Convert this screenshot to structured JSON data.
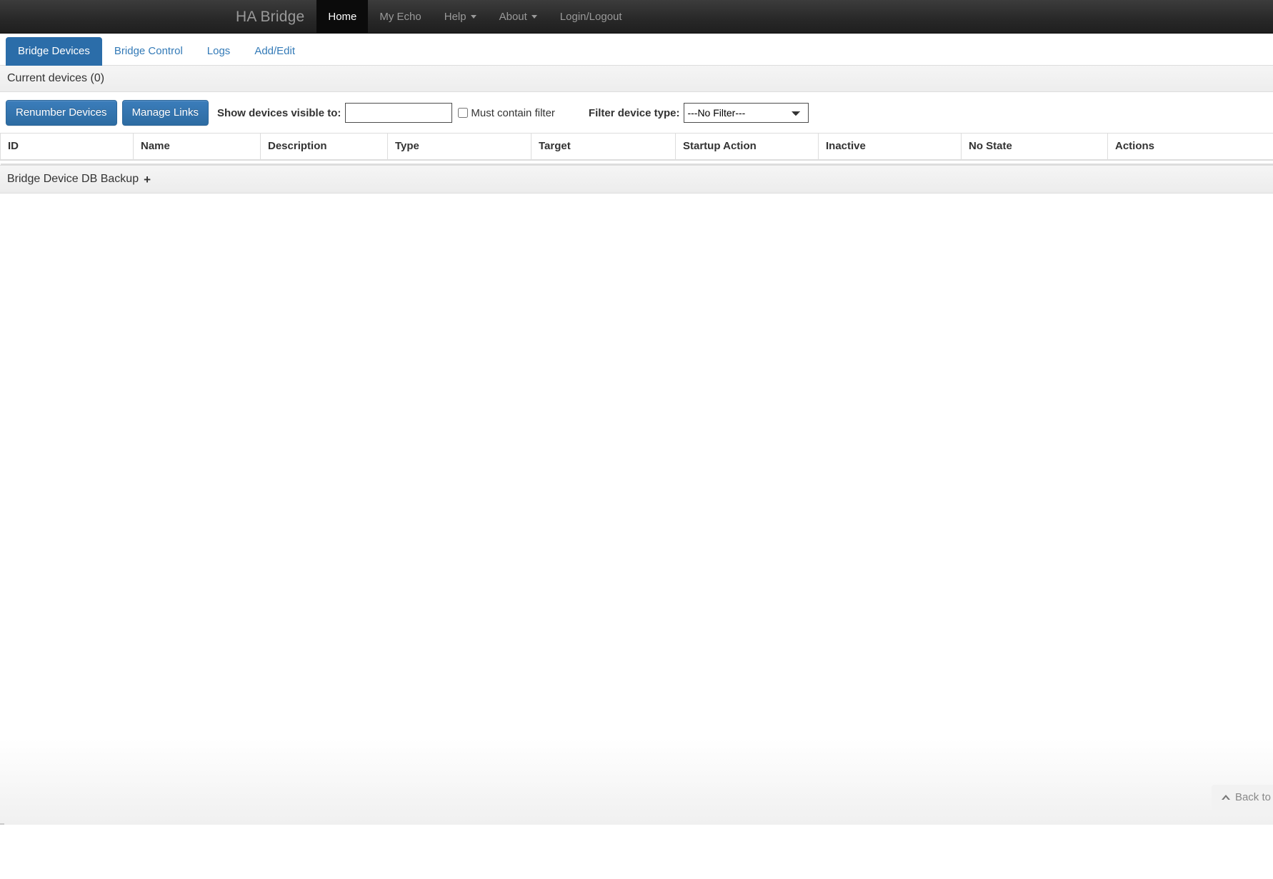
{
  "navbar": {
    "brand": "HA Bridge",
    "items": [
      {
        "label": "Home",
        "active": true,
        "caret": false
      },
      {
        "label": "My Echo",
        "active": false,
        "caret": false
      },
      {
        "label": "Help",
        "active": false,
        "caret": true
      },
      {
        "label": "About",
        "active": false,
        "caret": true
      },
      {
        "label": "Login/Logout",
        "active": false,
        "caret": false
      }
    ]
  },
  "tabs": [
    {
      "label": "Bridge Devices",
      "active": true
    },
    {
      "label": "Bridge Control",
      "active": false
    },
    {
      "label": "Logs",
      "active": false
    },
    {
      "label": "Add/Edit",
      "active": false
    }
  ],
  "panel": {
    "heading": "Current devices (0)"
  },
  "toolbar": {
    "renumber_label": "Renumber Devices",
    "manage_links_label": "Manage Links",
    "visible_to_label": "Show devices visible to:",
    "visible_to_value": "",
    "visible_to_placeholder": "",
    "must_contain_label": "Must contain filter",
    "must_contain_checked": false,
    "filter_type_label": "Filter device type:",
    "filter_type_value": "---No Filter---",
    "filter_type_options": [
      "---No Filter---"
    ]
  },
  "table": {
    "columns": [
      "ID",
      "Name",
      "Description",
      "Type",
      "Target",
      "Startup Action",
      "Inactive",
      "No State",
      "Actions"
    ],
    "rows": []
  },
  "backup": {
    "heading": "Bridge Device DB Backup",
    "expand_icon": "+"
  },
  "back_to_top": {
    "label": "Back to top"
  },
  "colors": {
    "navbar_dark": "#282828",
    "navbar_active": "#0b0b0b",
    "link_blue": "#337ab7",
    "tab_active_blue": "#2b6da9",
    "button_blue": "#2d6ca2",
    "panel_gray": "#f0f0f0",
    "border_gray": "#dddddd"
  }
}
